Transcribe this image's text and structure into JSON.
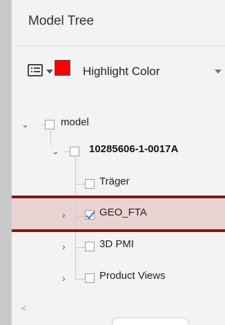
{
  "panel": {
    "title": "Model Tree"
  },
  "toolbar": {
    "view_icon": "list-view-icon",
    "dropdown_icon": "chevron-down-icon",
    "highlight_color": "#ff0000",
    "highlight_label": "Highlight Color"
  },
  "tree": {
    "nodes": [
      {
        "label": "model",
        "expanded": true,
        "checked": false
      },
      {
        "label": "10285606-1-0017A",
        "expanded": true,
        "checked": false,
        "bold": true
      },
      {
        "label": "Träger",
        "expandable": false,
        "checked": false
      },
      {
        "label": "GEO_FTA",
        "expanded": false,
        "checked": true,
        "selected": true
      },
      {
        "label": "3D PMI",
        "expanded": false,
        "checked": false
      },
      {
        "label": "Product Views",
        "expanded": false,
        "checked": false
      }
    ]
  },
  "colors": {
    "selection_border": "#8b1414",
    "selection_bg": "#ead3d3"
  }
}
